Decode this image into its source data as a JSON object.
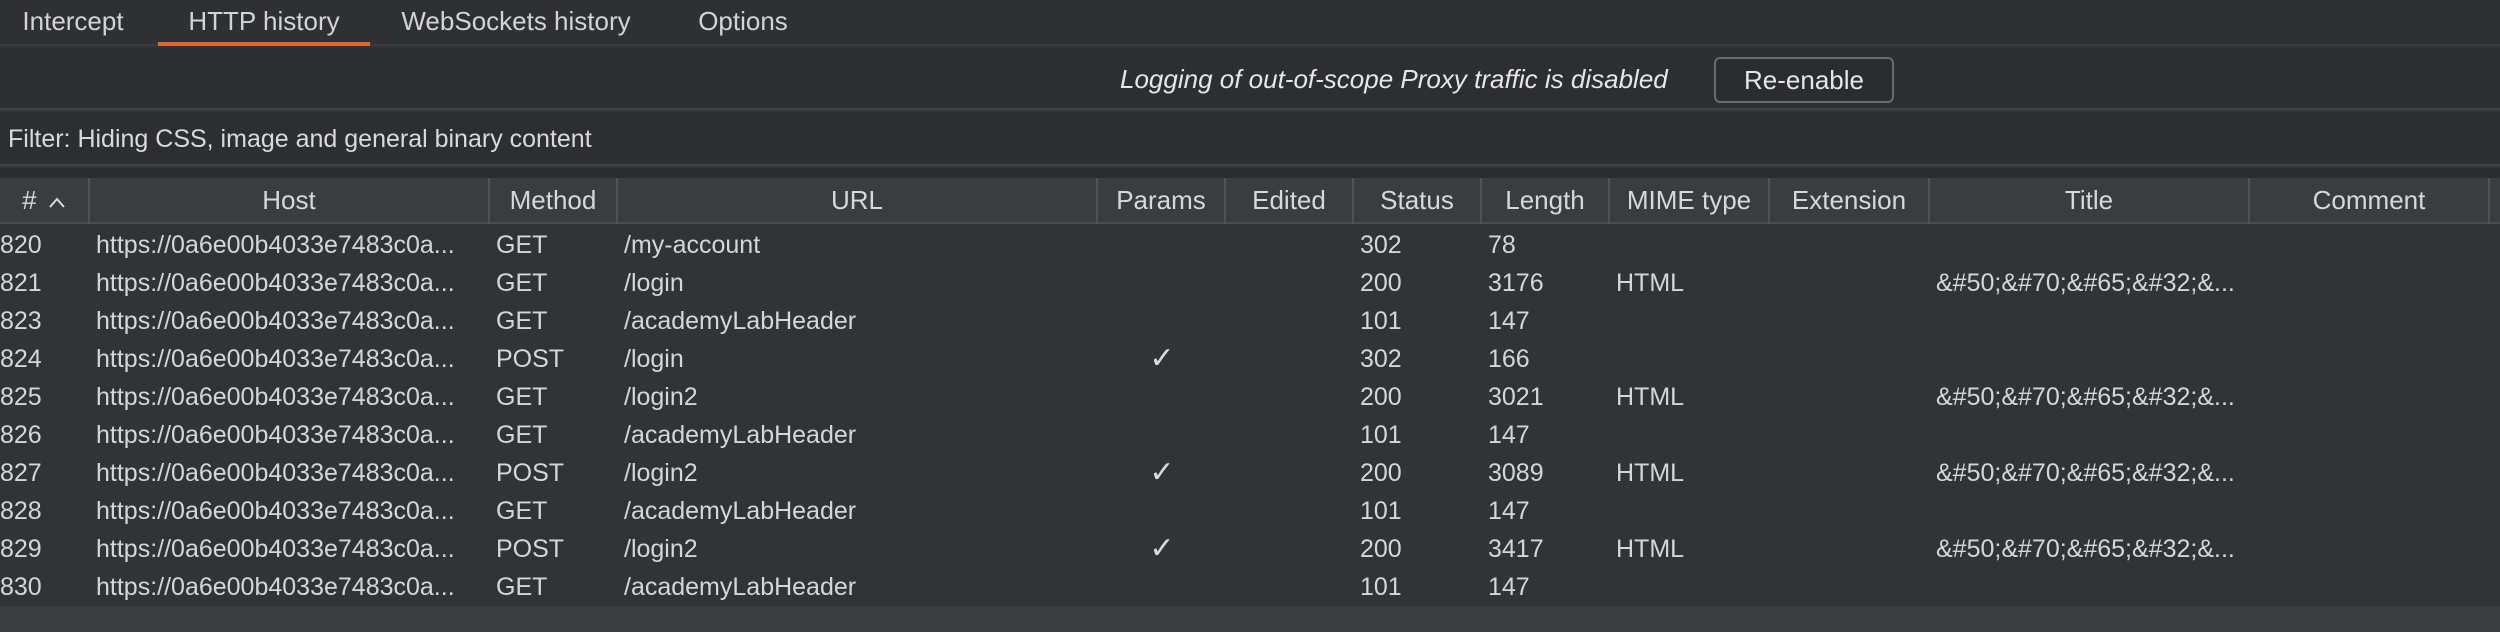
{
  "tabs": [
    {
      "label": "Intercept"
    },
    {
      "label": "HTTP history"
    },
    {
      "label": "WebSockets history"
    },
    {
      "label": "Options"
    }
  ],
  "notice": {
    "text": "Logging of out-of-scope Proxy traffic is disabled",
    "button": "Re-enable"
  },
  "filter": {
    "text": "Filter: Hiding CSS, image and general binary content"
  },
  "table": {
    "columns": [
      "#",
      "Host",
      "Method",
      "URL",
      "Params",
      "Edited",
      "Status",
      "Length",
      "MIME type",
      "Extension",
      "Title",
      "Comment"
    ],
    "sort_icon": "chevron-up-icon",
    "rows": [
      {
        "num": "820",
        "host": "https://0a6e00b4033e7483c0a...",
        "method": "GET",
        "url": "/my-account",
        "params": "",
        "status": "302",
        "length": "78",
        "mime": "",
        "title": ""
      },
      {
        "num": "821",
        "host": "https://0a6e00b4033e7483c0a...",
        "method": "GET",
        "url": "/login",
        "params": "",
        "status": "200",
        "length": "3176",
        "mime": "HTML",
        "title": "&#50;&#70;&#65;&#32;&..."
      },
      {
        "num": "823",
        "host": "https://0a6e00b4033e7483c0a...",
        "method": "GET",
        "url": "/academyLabHeader",
        "params": "",
        "status": "101",
        "length": "147",
        "mime": "",
        "title": ""
      },
      {
        "num": "824",
        "host": "https://0a6e00b4033e7483c0a...",
        "method": "POST",
        "url": "/login",
        "params": "✓",
        "status": "302",
        "length": "166",
        "mime": "",
        "title": ""
      },
      {
        "num": "825",
        "host": "https://0a6e00b4033e7483c0a...",
        "method": "GET",
        "url": "/login2",
        "params": "",
        "status": "200",
        "length": "3021",
        "mime": "HTML",
        "title": "&#50;&#70;&#65;&#32;&..."
      },
      {
        "num": "826",
        "host": "https://0a6e00b4033e7483c0a...",
        "method": "GET",
        "url": "/academyLabHeader",
        "params": "",
        "status": "101",
        "length": "147",
        "mime": "",
        "title": ""
      },
      {
        "num": "827",
        "host": "https://0a6e00b4033e7483c0a...",
        "method": "POST",
        "url": "/login2",
        "params": "✓",
        "status": "200",
        "length": "3089",
        "mime": "HTML",
        "title": "&#50;&#70;&#65;&#32;&..."
      },
      {
        "num": "828",
        "host": "https://0a6e00b4033e7483c0a...",
        "method": "GET",
        "url": "/academyLabHeader",
        "params": "",
        "status": "101",
        "length": "147",
        "mime": "",
        "title": ""
      },
      {
        "num": "829",
        "host": "https://0a6e00b4033e7483c0a...",
        "method": "POST",
        "url": "/login2",
        "params": "✓",
        "status": "200",
        "length": "3417",
        "mime": "HTML",
        "title": "&#50;&#70;&#65;&#32;&..."
      },
      {
        "num": "830",
        "host": "https://0a6e00b4033e7483c0a...",
        "method": "GET",
        "url": "/academyLabHeader",
        "params": "",
        "status": "101",
        "length": "147",
        "mime": "",
        "title": ""
      }
    ]
  },
  "colors": {
    "background": "#313335",
    "header": "#3a3c3e",
    "active_tab_accent": "#e0663a",
    "text": "#d4d6d8"
  }
}
